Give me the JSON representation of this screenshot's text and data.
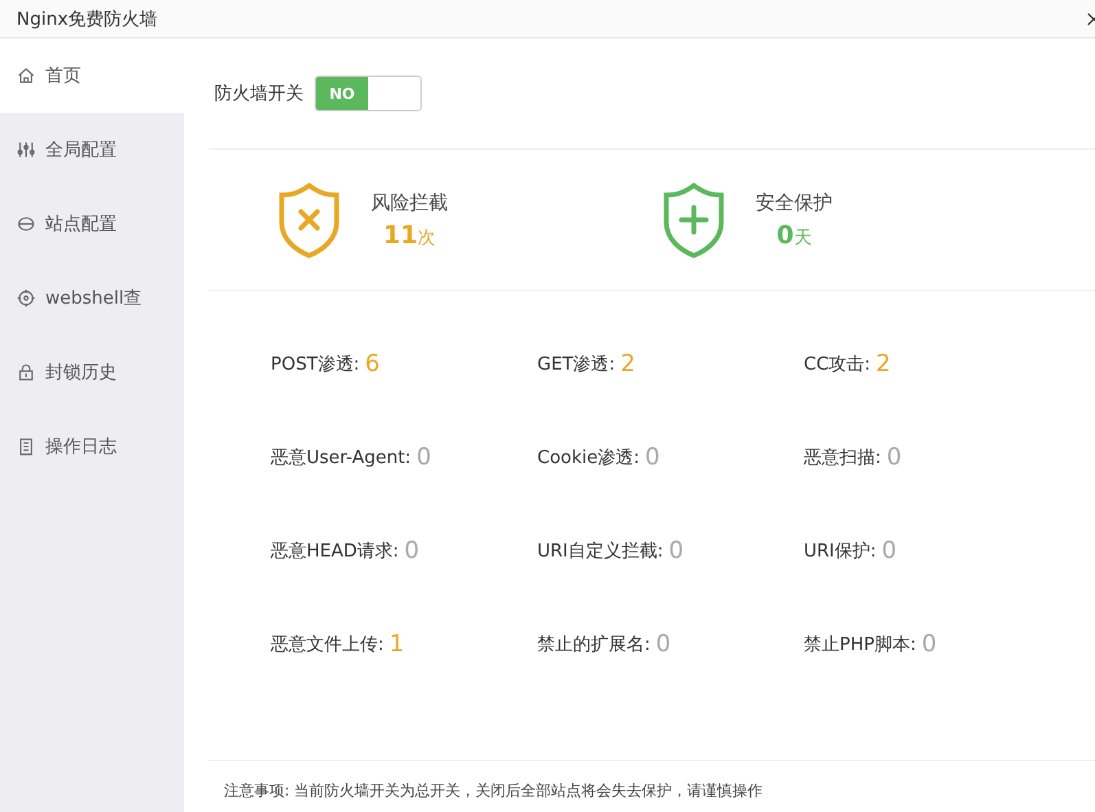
{
  "window": {
    "title": "Nginx免费防火墙"
  },
  "sidebar": {
    "items": [
      {
        "label": "首页",
        "selected": true
      },
      {
        "label": "全局配置",
        "selected": false
      },
      {
        "label": "站点配置",
        "selected": false
      },
      {
        "label": "webshell查",
        "selected": false
      },
      {
        "label": "封锁历史",
        "selected": false
      },
      {
        "label": "操作日志",
        "selected": false
      }
    ]
  },
  "firewall_switch": {
    "label": "防火墙开关",
    "on": true,
    "text": "NO"
  },
  "summary": [
    {
      "kind": "risk",
      "title": "风险拦截",
      "value": "11",
      "unit": "次",
      "color": "#e8a823"
    },
    {
      "kind": "safe",
      "title": "安全保护",
      "value": "0",
      "unit": "天",
      "color": "#5cb85c"
    }
  ],
  "stats": [
    {
      "label": "POST渗透:",
      "value": "6",
      "active": true
    },
    {
      "label": "GET渗透:",
      "value": "2",
      "active": true
    },
    {
      "label": "CC攻击:",
      "value": "2",
      "active": true
    },
    {
      "label": "恶意User-Agent:",
      "value": "0",
      "active": false
    },
    {
      "label": "Cookie渗透:",
      "value": "0",
      "active": false
    },
    {
      "label": "恶意扫描:",
      "value": "0",
      "active": false
    },
    {
      "label": "恶意HEAD请求:",
      "value": "0",
      "active": false
    },
    {
      "label": "URI自定义拦截:",
      "value": "0",
      "active": false
    },
    {
      "label": "URI保护:",
      "value": "0",
      "active": false
    },
    {
      "label": "恶意文件上传:",
      "value": "1",
      "active": true
    },
    {
      "label": "禁止的扩展名:",
      "value": "0",
      "active": false
    },
    {
      "label": "禁止PHP脚本:",
      "value": "0",
      "active": false
    }
  ],
  "note": "注意事项: 当前防火墙开关为总开关，关闭后全部站点将会失去保护，请谨慎操作"
}
